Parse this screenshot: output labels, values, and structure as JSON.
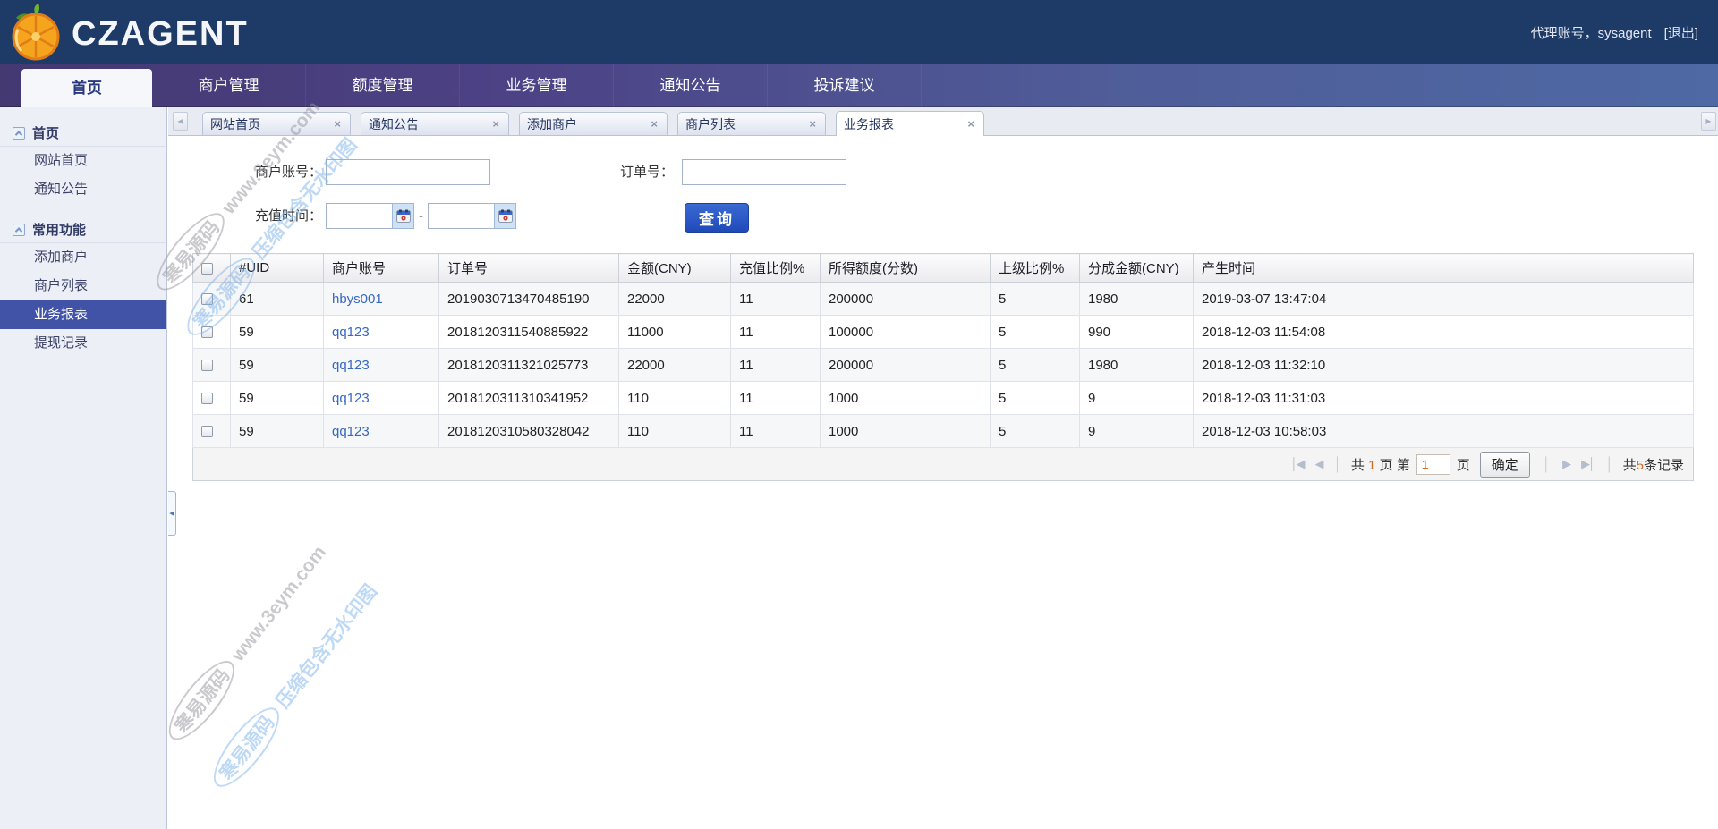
{
  "header": {
    "logo_text": "CZAGENT",
    "user_info": "代理账号，sysagent",
    "logout_label": "[退出]"
  },
  "nav": {
    "items": [
      {
        "label": "首页",
        "active": true
      },
      {
        "label": "商户管理"
      },
      {
        "label": "额度管理"
      },
      {
        "label": "业务管理"
      },
      {
        "label": "通知公告"
      },
      {
        "label": "投诉建议"
      }
    ]
  },
  "sidebar": {
    "sections": [
      {
        "title": "首页",
        "items": [
          {
            "label": "网站首页"
          },
          {
            "label": "通知公告"
          }
        ]
      },
      {
        "title": "常用功能",
        "items": [
          {
            "label": "添加商户"
          },
          {
            "label": "商户列表"
          },
          {
            "label": "业务报表",
            "active": true
          },
          {
            "label": "提现记录"
          }
        ]
      }
    ]
  },
  "tabs": {
    "items": [
      {
        "label": "网站首页"
      },
      {
        "label": "通知公告"
      },
      {
        "label": "添加商户"
      },
      {
        "label": "商户列表"
      },
      {
        "label": "业务报表",
        "active": true
      }
    ]
  },
  "form": {
    "merchant_label": "商户账号：",
    "merchant_value": "",
    "order_label": "订单号：",
    "order_value": "",
    "time_label": "充值时间：",
    "time_from": "",
    "time_to": "",
    "range_separator": "-",
    "search_button": "查询"
  },
  "table": {
    "columns": [
      "#UID",
      "商户账号",
      "订单号",
      "金额(CNY)",
      "充值比例%",
      "所得额度(分数)",
      "上级比例%",
      "分成金额(CNY)",
      "产生时间"
    ],
    "rows": [
      {
        "uid": "61",
        "account": "hbys001",
        "order_no": "2019030713470485190",
        "amount": "22000",
        "recharge_ratio": "11",
        "credit": "200000",
        "parent_ratio": "5",
        "share_amount": "1980",
        "created_at": "2019-03-07 13:47:04"
      },
      {
        "uid": "59",
        "account": "qq123",
        "order_no": "2018120311540885922",
        "amount": "11000",
        "recharge_ratio": "11",
        "credit": "100000",
        "parent_ratio": "5",
        "share_amount": "990",
        "created_at": "2018-12-03 11:54:08"
      },
      {
        "uid": "59",
        "account": "qq123",
        "order_no": "2018120311321025773",
        "amount": "22000",
        "recharge_ratio": "11",
        "credit": "200000",
        "parent_ratio": "5",
        "share_amount": "1980",
        "created_at": "2018-12-03 11:32:10"
      },
      {
        "uid": "59",
        "account": "qq123",
        "order_no": "2018120311310341952",
        "amount": "110",
        "recharge_ratio": "11",
        "credit": "1000",
        "parent_ratio": "5",
        "share_amount": "9",
        "created_at": "2018-12-03 11:31:03"
      },
      {
        "uid": "59",
        "account": "qq123",
        "order_no": "2018120310580328042",
        "amount": "110",
        "recharge_ratio": "11",
        "credit": "1000",
        "parent_ratio": "5",
        "share_amount": "9",
        "created_at": "2018-12-03 10:58:03"
      }
    ]
  },
  "pagination": {
    "pages_prefix": "共",
    "total_pages": "1",
    "pages_mid": "页 第",
    "page_input_value": "1",
    "pages_suffix": "页",
    "confirm_label": "确定",
    "records_prefix": "共",
    "records_count": "5",
    "records_suffix": "条记录"
  },
  "watermark": {
    "badge": "寒易源码",
    "site": "www.3eym.com",
    "note": "压缩包含无水印图"
  },
  "icons": {
    "close": "×",
    "prev": "◀",
    "next": "▶",
    "first": "│◀",
    "last": "▶│",
    "collapse_left": "◀"
  },
  "colors": {
    "header_bg": "#1e3a66",
    "nav_gradient_start": "#443971",
    "nav_gradient_end": "#4e69a4",
    "sidebar_active": "#4053a6",
    "accent_button": "#2456c0",
    "link": "#3668c4",
    "pagination_number": "#d4691f"
  }
}
